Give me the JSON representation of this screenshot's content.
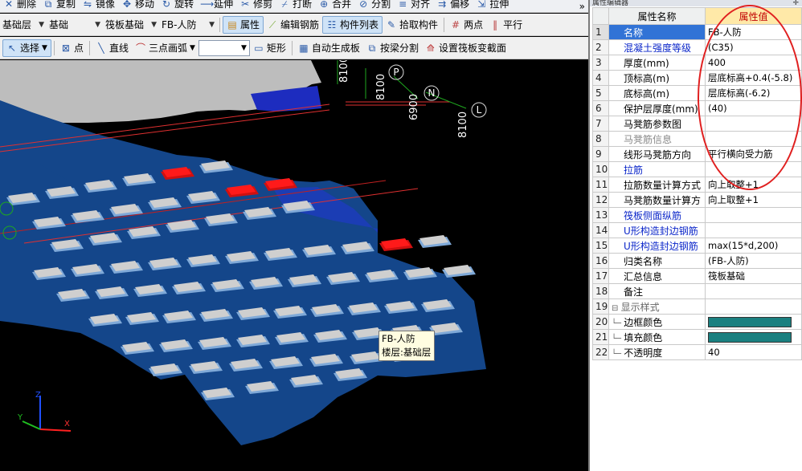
{
  "toolbar1": {
    "items": [
      {
        "name": "delete",
        "label": "删除"
      },
      {
        "name": "copy",
        "label": "复制"
      },
      {
        "name": "mirror",
        "label": "镜像"
      },
      {
        "name": "move",
        "label": "移动"
      },
      {
        "name": "rotate",
        "label": "旋转"
      },
      {
        "name": "extend",
        "label": "延伸"
      },
      {
        "name": "trim",
        "label": "修剪"
      },
      {
        "name": "break",
        "label": "打断"
      },
      {
        "name": "merge",
        "label": "合并"
      },
      {
        "name": "split",
        "label": "分割"
      },
      {
        "name": "align",
        "label": "对齐"
      },
      {
        "name": "offset",
        "label": "偏移"
      },
      {
        "name": "stretch",
        "label": "拉伸"
      }
    ],
    "overflow": "»"
  },
  "toolbar2": {
    "floor": "基础层",
    "category": "基础",
    "type": "筏板基础",
    "component": "FB-人防",
    "properties": "属性",
    "edit_rebar": "编辑钢筋",
    "component_list": "构件列表",
    "pick": "拾取构件",
    "two_points": "两点",
    "parallel": "平行"
  },
  "toolbar3": {
    "select": "选择",
    "point": "点",
    "line": "直线",
    "arc": "三点画弧",
    "rect": "矩形",
    "auto_gen": "自动生成板",
    "beam_split": "按梁分割",
    "set_section": "设置筏板变截面"
  },
  "viewport": {
    "axis_labels": [
      "P",
      "N",
      "L"
    ],
    "dims": [
      "8100",
      "8100",
      "6900",
      "8100"
    ],
    "axis_xyz": [
      "X",
      "Y",
      "Z"
    ],
    "tooltip": {
      "line1": "FB-人防",
      "line2": "楼层:基础层"
    },
    "colors": {
      "slab": "#14468a",
      "bg": "#000000",
      "pit": "#c9c9c9",
      "red": "#ff0000"
    }
  },
  "panel": {
    "title": "属性编辑器",
    "pin": "✛",
    "col_name": "属性名称",
    "col_value": "属性值",
    "rows": [
      {
        "n": "1",
        "name": "名称",
        "value": "FB-人防",
        "blue": false
      },
      {
        "n": "2",
        "name": "混凝土强度等级",
        "value": "(C35)",
        "blue": true
      },
      {
        "n": "3",
        "name": "厚度(mm)",
        "value": "400",
        "blue": false
      },
      {
        "n": "4",
        "name": "顶标高(m)",
        "value": "层底标高+0.4(-5.8)",
        "blue": false
      },
      {
        "n": "5",
        "name": "底标高(m)",
        "value": "层底标高(-6.2)",
        "blue": false
      },
      {
        "n": "6",
        "name": "保护层厚度(mm)",
        "value": "(40)",
        "blue": false
      },
      {
        "n": "7",
        "name": "马凳筋参数图",
        "value": "",
        "blue": false
      },
      {
        "n": "8",
        "name": "马凳筋信息",
        "value": "",
        "blue": false
      },
      {
        "n": "9",
        "name": "线形马凳筋方向",
        "value": "平行横向受力筋",
        "blue": false
      },
      {
        "n": "10",
        "name": "拉筋",
        "value": "",
        "blue": true
      },
      {
        "n": "11",
        "name": "拉筋数量计算方式",
        "value": "向上取整+1",
        "blue": false
      },
      {
        "n": "12",
        "name": "马凳筋数量计算方",
        "value": "向上取整+1",
        "blue": false
      },
      {
        "n": "13",
        "name": "筏板侧面纵筋",
        "value": "",
        "blue": true
      },
      {
        "n": "14",
        "name": "U形构造封边钢筋",
        "value": "",
        "blue": true
      },
      {
        "n": "15",
        "name": "U形构造封边钢筋",
        "value": "max(15*d,200)",
        "blue": true
      },
      {
        "n": "16",
        "name": "归类名称",
        "value": "(FB-人防)",
        "blue": false
      },
      {
        "n": "17",
        "name": "汇总信息",
        "value": "筏板基础",
        "blue": false
      },
      {
        "n": "18",
        "name": "备注",
        "value": "",
        "blue": false
      },
      {
        "n": "19",
        "name": "显示样式",
        "value": "",
        "blue": false,
        "group": true
      },
      {
        "n": "20",
        "name": "边框颜色",
        "value": "",
        "blue": false,
        "color": "#1a8080",
        "child": true
      },
      {
        "n": "21",
        "name": "填充颜色",
        "value": "",
        "blue": false,
        "color": "#1a8080",
        "child": true
      },
      {
        "n": "22",
        "name": "不透明度",
        "value": "40",
        "blue": false,
        "child": true
      }
    ]
  }
}
